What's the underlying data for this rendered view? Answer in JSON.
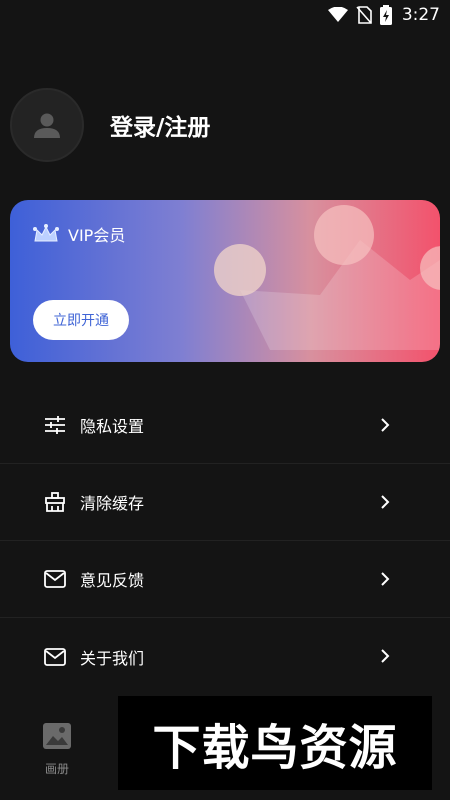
{
  "status_bar": {
    "time": "3:27",
    "icons": [
      "wifi-icon",
      "no-sim-icon",
      "battery-charging-icon"
    ]
  },
  "profile": {
    "login_text": "登录/注册"
  },
  "vip": {
    "title": "VIP会员",
    "button": "立即开通",
    "colors": {
      "start": "#3e60d8",
      "end": "#f3526c",
      "button_text": "#3f64d6"
    }
  },
  "menu": [
    {
      "label": "隐私设置",
      "icon": "sliders-icon"
    },
    {
      "label": "清除缓存",
      "icon": "broom-icon"
    },
    {
      "label": "意见反馈",
      "icon": "mail-icon"
    },
    {
      "label": "关于我们",
      "icon": "mail-icon"
    }
  ],
  "bottom_nav": {
    "album_label": "画册"
  },
  "watermark": "下载鸟资源"
}
